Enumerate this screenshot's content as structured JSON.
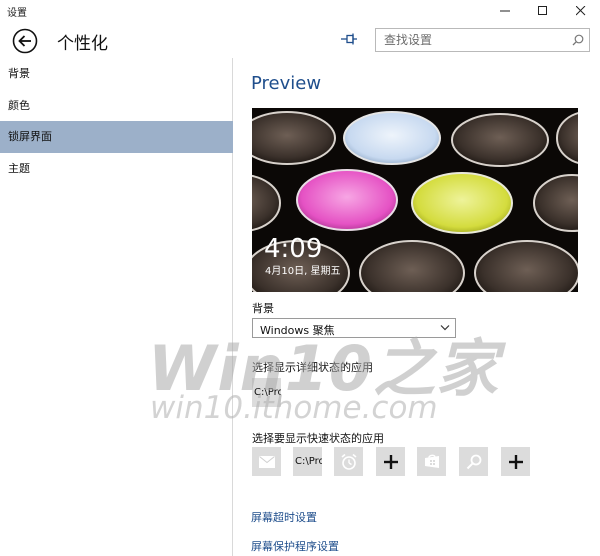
{
  "window": {
    "title": "设置",
    "controls": [
      "minimize",
      "maximize",
      "close"
    ]
  },
  "header": {
    "title": "个性化",
    "back_icon": "back-arrow-icon",
    "pin_icon": "pin-icon",
    "search": {
      "placeholder": "查找设置",
      "icon": "search-icon"
    }
  },
  "sidebar": {
    "items": [
      {
        "label": "背景",
        "selected": false
      },
      {
        "label": "颜色",
        "selected": false
      },
      {
        "label": "锁屏界面",
        "selected": true
      },
      {
        "label": "主题",
        "selected": false
      }
    ],
    "selected_color": "#9cb0c9"
  },
  "main": {
    "preview_title": "Preview",
    "lock_time": "4:09",
    "lock_date": "4月10日, 星期五",
    "background_label": "背景",
    "background_value": "Windows 聚焦",
    "detailed_status_label": "选择显示详细状态的应用",
    "detailed_status_app": "C:\\Pro",
    "quick_status_label": "选择要显示快速状态的应用",
    "quick_status_apps": [
      {
        "type": "icon",
        "icon": "mail-icon"
      },
      {
        "type": "text",
        "text": "C:\\Pro"
      },
      {
        "type": "icon",
        "icon": "alarm-icon"
      },
      {
        "type": "icon",
        "icon": "plus-icon"
      },
      {
        "type": "icon",
        "icon": "store-icon"
      },
      {
        "type": "icon",
        "icon": "search-icon"
      },
      {
        "type": "icon",
        "icon": "plus-icon"
      }
    ],
    "links": [
      "屏幕超时设置",
      "屏幕保护程序设置"
    ],
    "accent_color": "#1f4e8c"
  },
  "watermark": {
    "big": "Win10之家",
    "small": "win10.ithome.com"
  }
}
